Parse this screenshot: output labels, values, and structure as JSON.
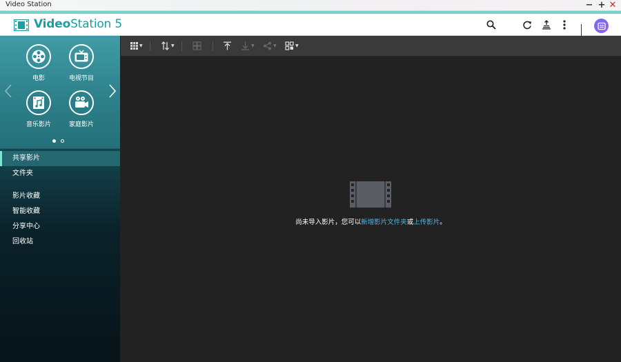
{
  "window": {
    "title": "Video Station",
    "controls": {
      "minimize": "−",
      "maximize": "+",
      "close": "✕"
    }
  },
  "header": {
    "brand_bold": "Video",
    "brand_rest": "Station 5",
    "icons": [
      "search-icon",
      "refresh-icon",
      "background-tasks-icon",
      "more-options-icon",
      "avatar-icon"
    ]
  },
  "shortcuts": {
    "items": [
      {
        "label": "电影",
        "icon": "film-reel-icon"
      },
      {
        "label": "电视节目",
        "icon": "tv-icon"
      },
      {
        "label": "音乐影片",
        "icon": "music-video-icon"
      },
      {
        "label": "家庭影片",
        "icon": "home-video-camera-icon"
      }
    ],
    "page_count": 2,
    "current_page": 1
  },
  "sidebar": {
    "group1": [
      {
        "label": "共享影片",
        "active": true
      },
      {
        "label": "文件夹",
        "active": false
      }
    ],
    "group2": [
      {
        "label": "影片收藏",
        "active": false
      },
      {
        "label": "智能收藏",
        "active": false
      },
      {
        "label": "分享中心",
        "active": false
      },
      {
        "label": "回收站",
        "active": false
      }
    ]
  },
  "toolbar": {
    "buttons": [
      "view-mode",
      "sort",
      "filter",
      "upload",
      "download",
      "share",
      "multi-select"
    ]
  },
  "empty_state": {
    "prefix": "尚未导入影片，您可以",
    "link1": "新增影片文件夹",
    "middle": "或",
    "link2": "上传影片",
    "suffix": "。"
  },
  "colors": {
    "accent": "#1d9fa0",
    "title_accent": "#74d3c6",
    "link": "#4fb3e8",
    "content_bg": "#222222",
    "toolbar_bg": "#3a3a3a"
  }
}
